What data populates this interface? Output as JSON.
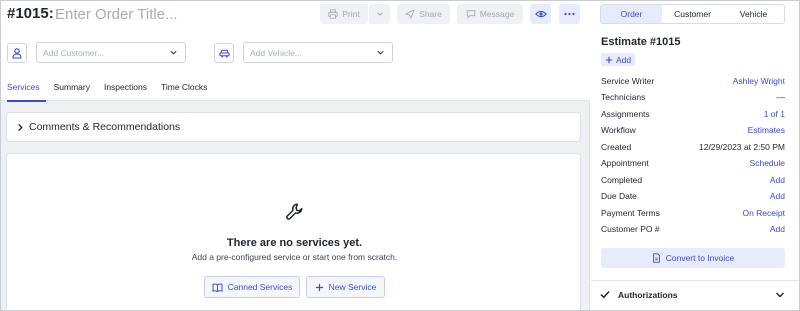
{
  "order": {
    "number": "#1015:",
    "title_placeholder": "Enter Order Title..."
  },
  "toolbar": {
    "print_label": "Print",
    "share_label": "Share",
    "message_label": "Message"
  },
  "customer_placeholder": "Add Customer...",
  "vehicle_placeholder": "Add Vehicle...",
  "tabs": [
    {
      "label": "Services",
      "active": true
    },
    {
      "label": "Summary"
    },
    {
      "label": "Inspections"
    },
    {
      "label": "Time Clocks"
    }
  ],
  "comments": {
    "label": "Comments & Recommendations"
  },
  "services_empty": {
    "title": "There are no services yet.",
    "subtitle": "Add a pre-configured service or start one from scratch.",
    "canned_label": "Canned Services",
    "new_label": "New Service"
  },
  "side": {
    "tabs": [
      {
        "label": "Order",
        "active": true
      },
      {
        "label": "Customer"
      },
      {
        "label": "Vehicle"
      }
    ],
    "estimate_title": "Estimate #1015",
    "add_label": "Add",
    "details": [
      {
        "key": "Service Writer",
        "value": "Ashley Wright"
      },
      {
        "key": "Technicians",
        "value": "—"
      },
      {
        "key": "Assignments",
        "value": "1 of 1"
      },
      {
        "key": "Workflow",
        "value": "Estimates"
      },
      {
        "key": "Created",
        "value": "12/29/2023 at 2:50 PM"
      },
      {
        "key": "Appointment",
        "value": "Schedule"
      },
      {
        "key": "Completed",
        "value": "Add"
      },
      {
        "key": "Due Date",
        "value": "Add"
      },
      {
        "key": "Payment Terms",
        "value": "On Receipt"
      },
      {
        "key": "Customer PO #",
        "value": "Add"
      }
    ],
    "convert_label": "Convert to Invoice",
    "authorizations_label": "Authorizations"
  },
  "colors": {
    "accent": "#3a4bd8",
    "accent_bg": "#e8ebfb",
    "canvas": "#eef0f4"
  },
  "icons": [
    "print-icon",
    "chevron-down-icon",
    "share-icon",
    "message-icon",
    "eye-icon",
    "more-icon",
    "user-icon",
    "car-icon",
    "chevron-right-icon",
    "wrench-icon",
    "book-icon",
    "plus-icon",
    "document-icon",
    "check-icon"
  ]
}
